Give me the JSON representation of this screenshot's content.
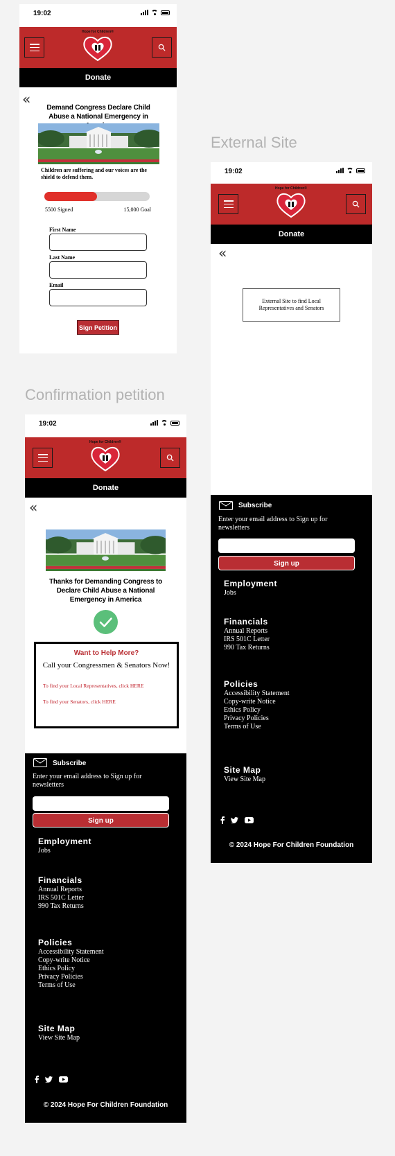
{
  "section_titles": {
    "external": "External Site",
    "confirmation": "Confirmation petition"
  },
  "status": {
    "time": "19:02"
  },
  "header": {
    "logo_text": "Hope for Children®",
    "donate_label": "Donate",
    "menu_icon": "hamburger-menu-icon",
    "search_icon": "search-icon",
    "back_icon": "double-chevron-left-icon"
  },
  "petition": {
    "title": "Demand Congress Declare Child Abuse a National Emergency in America",
    "description": "Children are suffering and our voices are the shield to defend them.",
    "progress_fraction": 0.5,
    "signed_label": "5500 Signed",
    "goal_label": "15,000 Goal",
    "first_name_label": "First Name",
    "last_name_label": "Last Name",
    "email_label": "Email",
    "sign_button": "Sign Petition"
  },
  "external": {
    "box_text": "External Site to find Local Representatives and Senators"
  },
  "confirmation": {
    "thanks": "Thanks for Demanding Congress to Declare Child Abuse a National Emergency in America",
    "help_title": "Want to Help More?",
    "help_subtitle": "Call your Congressmen & Senators Now!",
    "link_reps": "To find your Local Representatives, click HERE",
    "link_senators": "To find your Senators, click HERE"
  },
  "footer": {
    "subscribe_title": "Subscribe",
    "subscribe_text": "Enter your email address to Sign up for newsletters",
    "signup_button": "Sign up",
    "employment_title": "Employment",
    "employment_links": [
      "Jobs"
    ],
    "financials_title": "Financials",
    "financials_links": [
      "Annual Reports",
      "IRS 501C Letter",
      "990 Tax Returns"
    ],
    "policies_title": "Policies",
    "policies_links": [
      "Accessibility Statement",
      "Copy-write Notice",
      "Ethics Policy",
      "Privacy Policies",
      "Terms of Use"
    ],
    "sitemap_title": "Site Map",
    "sitemap_links": [
      "View Site Map"
    ],
    "social_icons": [
      "facebook-icon",
      "twitter-icon",
      "youtube-icon"
    ],
    "copyright": "© 2024 Hope For Children Foundation"
  },
  "colors": {
    "brand_red": "#bd2a2a",
    "button_red": "#b92e33",
    "progress_red": "#e0302a",
    "progress_track": "#d6d6d6",
    "success_green": "#5bbf7a",
    "background": "#f3f3f3"
  }
}
